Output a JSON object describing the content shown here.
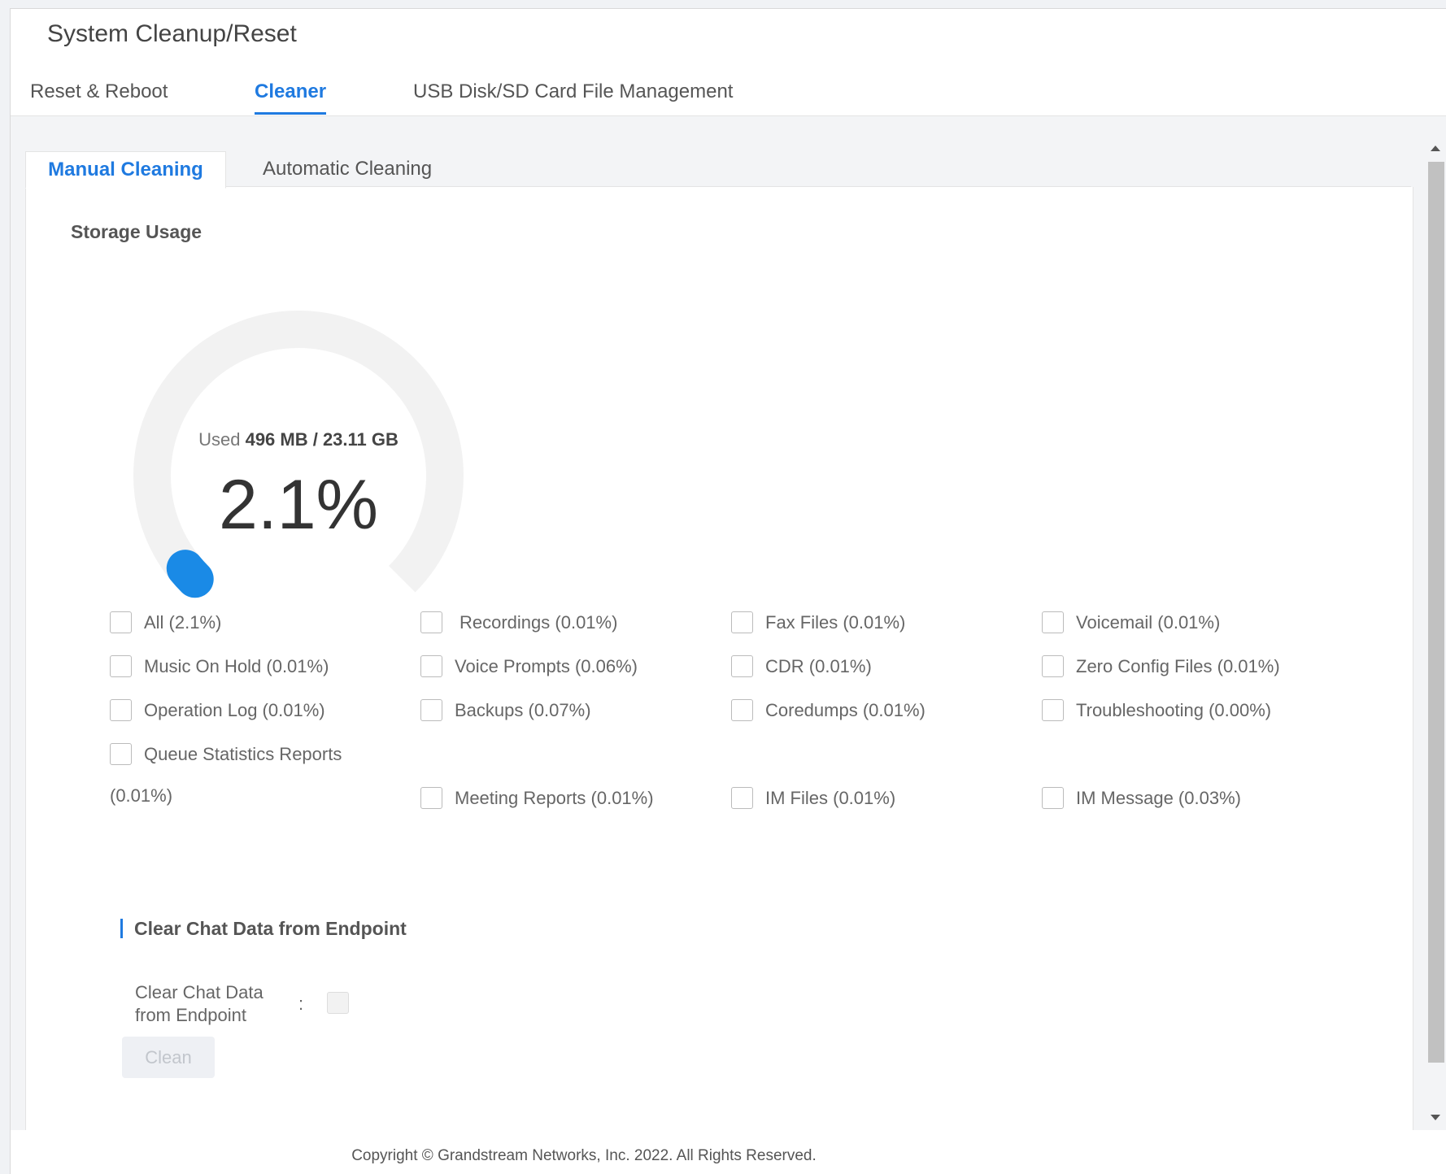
{
  "page": {
    "title": "System Cleanup/Reset"
  },
  "tabs": [
    {
      "label": "Reset & Reboot"
    },
    {
      "label": "Cleaner"
    },
    {
      "label": "USB Disk/SD Card File Management"
    }
  ],
  "sub_tabs": [
    {
      "label": "Manual Cleaning"
    },
    {
      "label": "Automatic Cleaning"
    }
  ],
  "storage": {
    "heading": "Storage Usage",
    "used_label": "Used",
    "used_value": "496 MB / 23.11 GB",
    "percent_label": "2.1%",
    "percent": 2.1
  },
  "options": [
    {
      "label": "All (2.1%)"
    },
    {
      "label": "Recordings (0.01%)"
    },
    {
      "label": "Fax Files (0.01%)"
    },
    {
      "label": "Voicemail (0.01%)"
    },
    {
      "label": "Music On Hold (0.01%)"
    },
    {
      "label": "Voice Prompts (0.06%)"
    },
    {
      "label": "CDR (0.01%)"
    },
    {
      "label": "Zero Config Files (0.01%)"
    },
    {
      "label": "Operation Log (0.01%)"
    },
    {
      "label": "Backups (0.07%)"
    },
    {
      "label": "Coredumps (0.01%)"
    },
    {
      "label": "Troubleshooting (0.00%)"
    },
    {
      "label": "Queue Statistics Reports"
    },
    {
      "label": "Meeting Reports (0.01%)"
    },
    {
      "label": "IM Files (0.01%)"
    },
    {
      "label": "IM Message (0.03%)"
    }
  ],
  "queue_stats_value": "(0.01%)",
  "chat": {
    "heading": "Clear Chat Data from Endpoint",
    "label": "Clear Chat Data from Endpoint",
    "colon": ":"
  },
  "clean_button": "Clean",
  "copyright": "Copyright © Grandstream Networks, Inc. 2022. All Rights Reserved."
}
